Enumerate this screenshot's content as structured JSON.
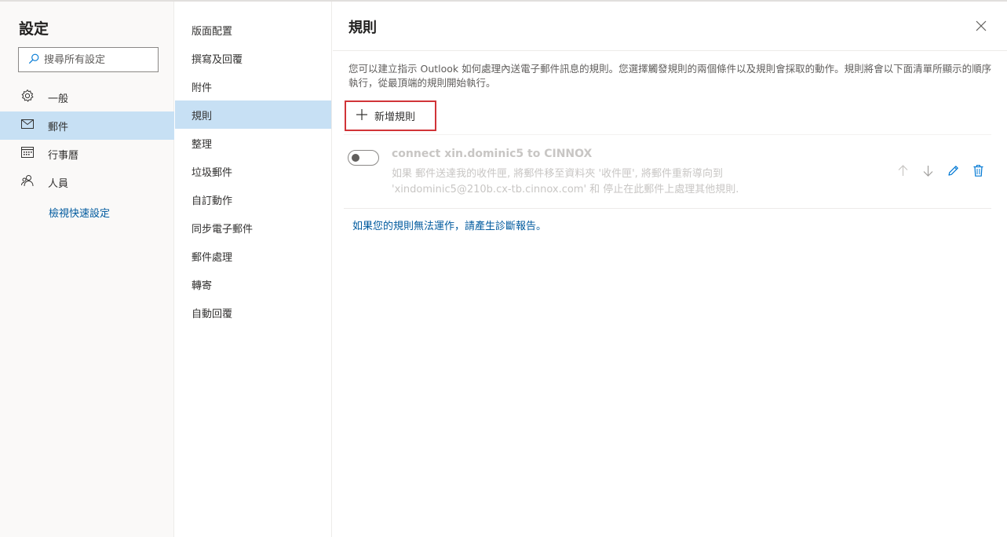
{
  "settings": {
    "title": "設定",
    "search_placeholder": "搜尋所有設定"
  },
  "nav": {
    "items": [
      {
        "label": "一般",
        "icon": "gear-icon"
      },
      {
        "label": "郵件",
        "icon": "mail-icon",
        "active": true
      },
      {
        "label": "行事曆",
        "icon": "calendar-icon"
      },
      {
        "label": "人員",
        "icon": "people-icon"
      }
    ],
    "quick_settings": "檢視快速設定"
  },
  "subnav": {
    "items": [
      {
        "label": "版面配置"
      },
      {
        "label": "撰寫及回覆"
      },
      {
        "label": "附件"
      },
      {
        "label": "規則",
        "active": true
      },
      {
        "label": "整理"
      },
      {
        "label": "垃圾郵件"
      },
      {
        "label": "自訂動作"
      },
      {
        "label": "同步電子郵件"
      },
      {
        "label": "郵件處理"
      },
      {
        "label": "轉寄"
      },
      {
        "label": "自動回覆"
      }
    ]
  },
  "content": {
    "title": "規則",
    "description": "您可以建立指示 Outlook 如何處理內送電子郵件訊息的規則。您選擇觸發規則的兩個條件以及規則會採取的動作。規則將會以下面清單所顯示的順序執行，從最頂端的規則開始執行。",
    "add_rule_label": "新增規則",
    "rules": [
      {
        "name": "connect xin.dominic5 to CINNOX",
        "desc_line1": "如果 郵件送達我的收件匣, 將郵件移至資料夾 '收件匣', 將郵件重新導向到",
        "desc_line2": "'xindominic5@210b.cx-tb.cinnox.com' 和 停止在此郵件上處理其他規則.",
        "enabled": false
      }
    ],
    "diag_prefix": "如果您的規則無法運作，",
    "diag_link": "請產生診斷報告。"
  },
  "colors": {
    "accent": "#0078d4",
    "selected_bg": "#c7e0f4",
    "highlight_border": "#d13438",
    "link": "#005a9e"
  }
}
